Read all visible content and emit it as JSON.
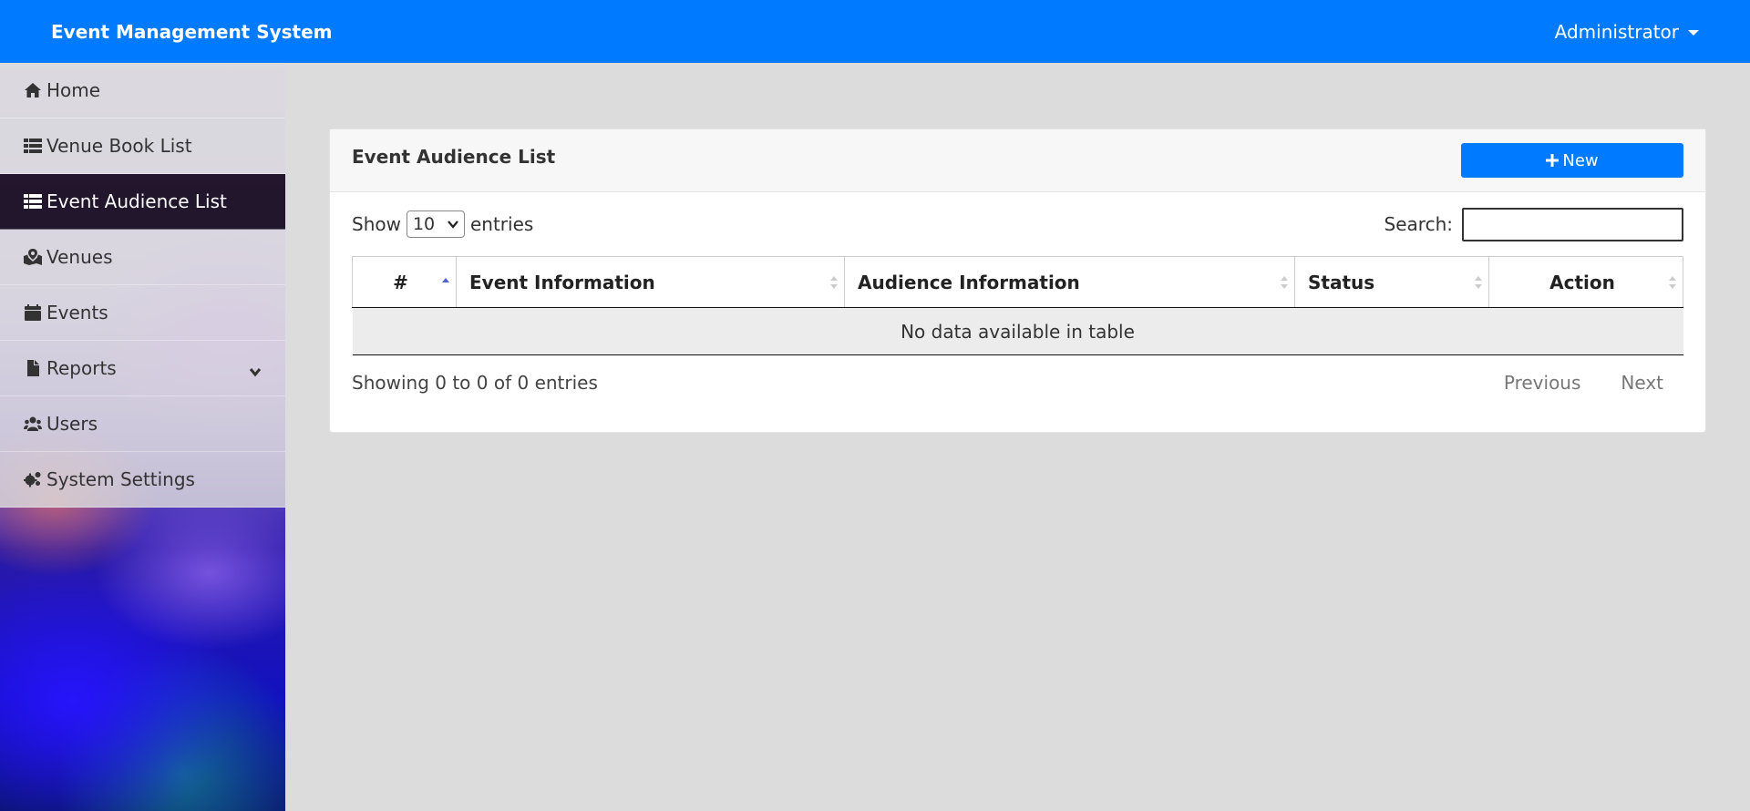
{
  "header": {
    "brand": "Event Management System",
    "user_menu": "Administrator"
  },
  "sidebar": {
    "items": [
      {
        "label": "Home",
        "icon": "home-icon",
        "active": false
      },
      {
        "label": "Venue Book List",
        "icon": "list-icon",
        "active": false
      },
      {
        "label": "Event Audience List",
        "icon": "list-icon",
        "active": true
      },
      {
        "label": "Venues",
        "icon": "map-marked-icon",
        "active": false
      },
      {
        "label": "Events",
        "icon": "calendar-icon",
        "active": false
      },
      {
        "label": "Reports",
        "icon": "file-icon",
        "active": false,
        "expandable": true
      },
      {
        "label": "Users",
        "icon": "users-icon",
        "active": false
      },
      {
        "label": "System Settings",
        "icon": "cogs-icon",
        "active": false
      }
    ]
  },
  "card": {
    "title": "Event Audience List",
    "new_button": "New",
    "show_label": "Show",
    "entries_value": "10",
    "entries_label": "entries",
    "search_label": "Search:",
    "search_value": "",
    "table": {
      "columns": [
        "#",
        "Event Information",
        "Audience Information",
        "Status",
        "Action"
      ],
      "empty_message": "No data available in table"
    },
    "info": "Showing 0 to 0 of 0 entries",
    "pagination": {
      "previous": "Previous",
      "next": "Next"
    }
  },
  "colors": {
    "primary": "#007bff",
    "sidebar_active": "#14081c",
    "page_bg": "#dcdcdc"
  }
}
